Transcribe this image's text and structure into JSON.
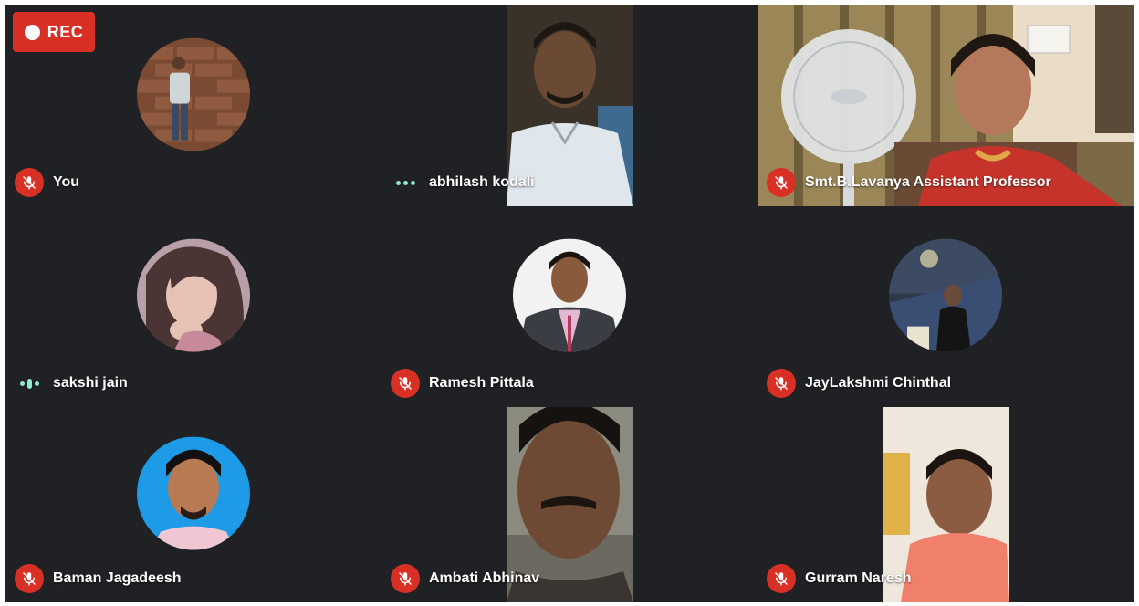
{
  "recording": {
    "label": "REC"
  },
  "participants": [
    {
      "name": "You",
      "mic": "muted"
    },
    {
      "name": "abhilash kodali",
      "mic": "speaking-idle"
    },
    {
      "name": "Smt.B.Lavanya Assistant Professor",
      "mic": "muted"
    },
    {
      "name": "sakshi jain",
      "mic": "speaking"
    },
    {
      "name": "Ramesh Pittala",
      "mic": "muted"
    },
    {
      "name": "JayLakshmi Chinthal",
      "mic": "muted"
    },
    {
      "name": "Baman Jagadeesh",
      "mic": "muted"
    },
    {
      "name": "Ambati Abhinav",
      "mic": "muted"
    },
    {
      "name": "Gurram Naresh",
      "mic": "muted"
    }
  ],
  "colors": {
    "background": "#202124",
    "mute_red": "#d93025",
    "speaking_teal": "#8ee9d6"
  },
  "icons": {
    "mic_off": "mic-off-icon",
    "record": "record-dot-icon",
    "speaking": "audio-level-icon"
  }
}
